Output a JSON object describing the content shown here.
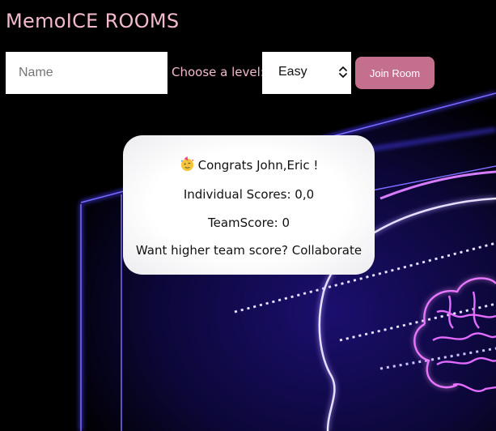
{
  "header": {
    "title": "MemoICE ROOMS"
  },
  "form": {
    "name_placeholder": "Name",
    "level_label": "Choose a level:",
    "level_selected": "Easy",
    "join_label": "Join Room"
  },
  "result": {
    "congrats": "Congrats John,Eric !",
    "individual_scores": "Individual Scores: 0,0",
    "team_score": "TeamScore: 0",
    "tip": "Want higher team score? Collaborate"
  },
  "icons": {
    "congrats": "partying-face-icon",
    "select": "chevron-up-down-icon",
    "background": "neon-brain-icon"
  },
  "colors": {
    "accent_text": "#f3b9cd",
    "button": "#c56f8f",
    "neon_blue": "#3a2cff",
    "neon_pink": "#e36cff"
  }
}
